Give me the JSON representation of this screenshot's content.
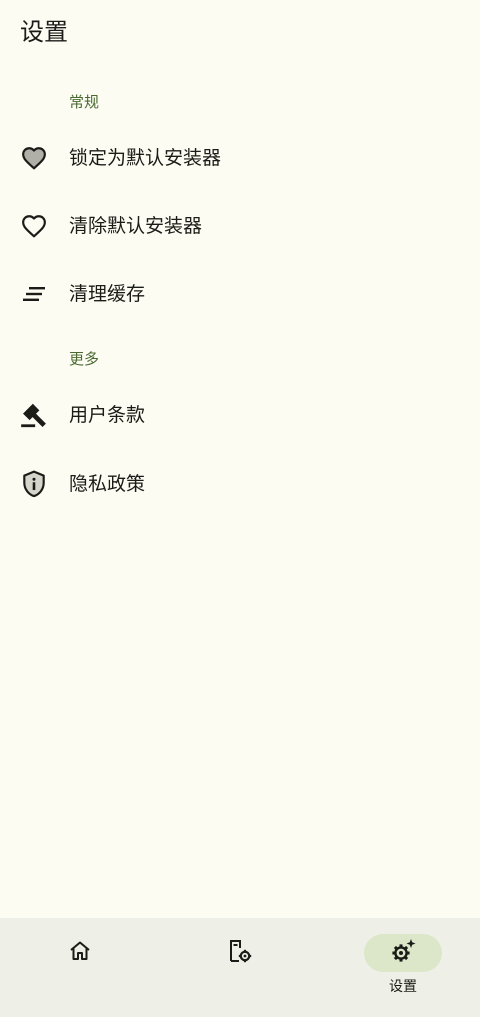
{
  "app": {
    "title": "设置"
  },
  "sections": {
    "general": {
      "header": "常规",
      "items": [
        {
          "label": "锁定为默认安装器",
          "icon": "heart-filled-icon"
        },
        {
          "label": "清除默认安装器",
          "icon": "heart-outline-icon"
        },
        {
          "label": "清理缓存",
          "icon": "clear-all-icon"
        }
      ]
    },
    "more": {
      "header": "更多",
      "items": [
        {
          "label": "用户条款",
          "icon": "gavel-icon"
        },
        {
          "label": "隐私政策",
          "icon": "privacy-shield-icon"
        }
      ]
    }
  },
  "bottom_nav": {
    "items": [
      {
        "icon": "home-icon",
        "label": ""
      },
      {
        "icon": "app-settings-icon",
        "label": ""
      },
      {
        "icon": "settings-sparkle-icon",
        "label": "设置",
        "active": true
      }
    ]
  },
  "colors": {
    "background": "#fcfcf3",
    "section_header": "#4a6a32",
    "nav_background": "#eeefe6",
    "nav_active_pill": "#dbe7c8"
  }
}
